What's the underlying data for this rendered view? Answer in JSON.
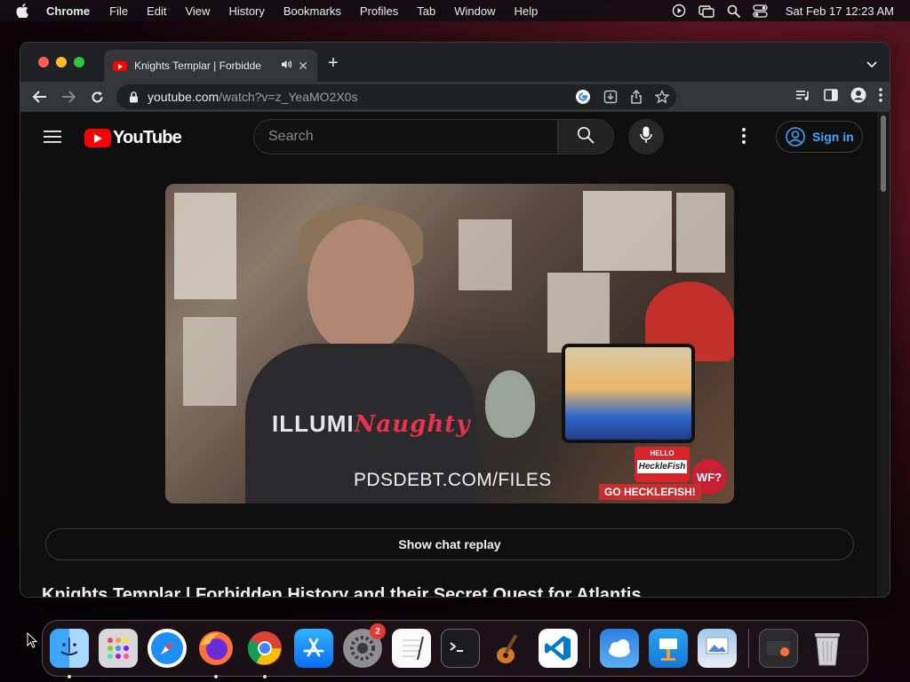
{
  "menubar": {
    "app_name": "Chrome",
    "items": [
      "File",
      "Edit",
      "View",
      "History",
      "Bookmarks",
      "Profiles",
      "Tab",
      "Window",
      "Help"
    ],
    "clock": "Sat Feb 17  12:23 AM"
  },
  "browser": {
    "tab_title": "Knights Templar | Forbidde",
    "url_host": "youtube.com",
    "url_path": "/watch?v=z_YeaMO2X0s"
  },
  "youtube": {
    "logo_text": "YouTube",
    "search_placeholder": "Search",
    "sign_in_label": "Sign in",
    "video_overlay": {
      "shirt_left": "ILLUMI",
      "shirt_right": "Naughty",
      "caption": "PDSDEBT.COM/FILES",
      "sticker_top": "HELLO",
      "sticker_name": "HeckleFish",
      "badge": "WF?",
      "book_label": "GO HECKLEFISH!"
    },
    "chat_replay_label": "Show chat replay",
    "video_title": "Knights Templar | Forbidden History and their Secret Quest for Atlantis"
  },
  "dock": {
    "settings_badge": "2",
    "items": [
      "Finder",
      "Launchpad",
      "Safari",
      "Firefox",
      "Chrome",
      "App Store",
      "System Settings",
      "TextEdit",
      "Terminal",
      "GarageBand",
      "Visual Studio Code",
      "Weather",
      "Keynote",
      "Preview",
      "Downloads",
      "Trash"
    ]
  },
  "colors": {
    "youtube_red": "#ff0000",
    "link_blue": "#3ea6ff",
    "page_bg": "#0f0f0f"
  }
}
